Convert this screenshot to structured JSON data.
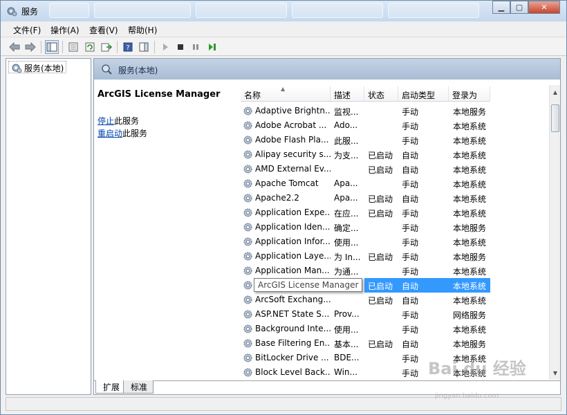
{
  "window": {
    "title": "服务"
  },
  "menu": [
    "文件(F)",
    "操作(A)",
    "查看(V)",
    "帮助(H)"
  ],
  "tree": {
    "root_label": "服务(本地)"
  },
  "main": {
    "header_title": "服务(本地)",
    "selected_service": "ArcGIS License Manager",
    "actions": [
      {
        "link": "停止",
        "suffix": "此服务"
      },
      {
        "link": "重启动",
        "suffix": "此服务"
      }
    ]
  },
  "table": {
    "columns": [
      "名称",
      "描述",
      "状态",
      "启动类型",
      "登录为"
    ],
    "rows": [
      {
        "name": "Adaptive Brightn...",
        "desc": "监视...",
        "status": "",
        "startup": "手动",
        "logon": "本地服务"
      },
      {
        "name": "Adobe Acrobat ...",
        "desc": "Ado...",
        "status": "",
        "startup": "手动",
        "logon": "本地系统"
      },
      {
        "name": "Adobe Flash Pla...",
        "desc": "此服...",
        "status": "",
        "startup": "手动",
        "logon": "本地系统"
      },
      {
        "name": "Alipay security s...",
        "desc": "为支...",
        "status": "已启动",
        "startup": "自动",
        "logon": "本地系统"
      },
      {
        "name": "AMD External Ev...",
        "desc": "",
        "status": "已启动",
        "startup": "自动",
        "logon": "本地系统"
      },
      {
        "name": "Apache Tomcat",
        "desc": "Apa...",
        "status": "",
        "startup": "手动",
        "logon": "本地系统"
      },
      {
        "name": "Apache2.2",
        "desc": "Apa...",
        "status": "已启动",
        "startup": "自动",
        "logon": "本地系统"
      },
      {
        "name": "Application Expe...",
        "desc": "在应...",
        "status": "已启动",
        "startup": "手动",
        "logon": "本地系统"
      },
      {
        "name": "Application Iden...",
        "desc": "确定...",
        "status": "",
        "startup": "手动",
        "logon": "本地服务"
      },
      {
        "name": "Application Infor...",
        "desc": "使用...",
        "status": "",
        "startup": "手动",
        "logon": "本地系统"
      },
      {
        "name": "Application Laye...",
        "desc": "为 In...",
        "status": "已启动",
        "startup": "手动",
        "logon": "本地服务"
      },
      {
        "name": "Application Man...",
        "desc": "为通...",
        "status": "",
        "startup": "手动",
        "logon": "本地系统"
      },
      {
        "name": "ArcGIS License Manager",
        "desc": "",
        "status": "已启动",
        "startup": "自动",
        "logon": "本地系统"
      },
      {
        "name": "ArcSoft Exchang...",
        "desc": "",
        "status": "已启动",
        "startup": "自动",
        "logon": "本地系统"
      },
      {
        "name": "ASP.NET State S...",
        "desc": "Prov...",
        "status": "",
        "startup": "手动",
        "logon": "网络服务"
      },
      {
        "name": "Background Inte...",
        "desc": "使用...",
        "status": "",
        "startup": "手动",
        "logon": "本地系统"
      },
      {
        "name": "Base Filtering En...",
        "desc": "基本...",
        "status": "已启动",
        "startup": "自动",
        "logon": "本地服务"
      },
      {
        "name": "BitLocker Drive ...",
        "desc": "BDE...",
        "status": "",
        "startup": "手动",
        "logon": "本地系统"
      },
      {
        "name": "Block Level Back...",
        "desc": "Win...",
        "status": "",
        "startup": "手动",
        "logon": "本地系统"
      }
    ]
  },
  "tabs": [
    "扩展",
    "标准"
  ],
  "watermark": {
    "brand": "Bai du 经验",
    "url": "jingyan.baidu.com"
  }
}
